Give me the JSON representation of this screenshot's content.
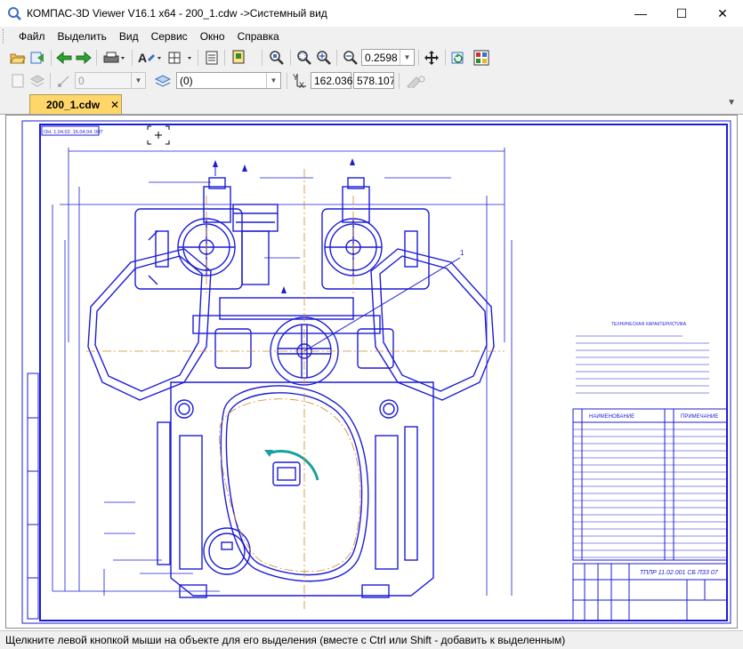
{
  "window": {
    "title": "КОМПАС-3D Viewer V16.1 x64 - 200_1.cdw ->Системный вид",
    "minimize_glyph": "—",
    "maximize_glyph": "☐",
    "close_glyph": "✕"
  },
  "menu": [
    "Файл",
    "Выделить",
    "Вид",
    "Сервис",
    "Окно",
    "Справка"
  ],
  "toolbar1": {
    "zoom_value": "0.2598",
    "icons": [
      "open-icon",
      "open-recent-icon",
      "back-arrow-icon",
      "forward-arrow-icon",
      "print-icon",
      "text-style-icon",
      "grid-icon",
      "properties-icon",
      "view-manager-icon",
      "zoom-fit-icon",
      "zoom-in-icon",
      "zoom-out-icon",
      "zoom-scale-icon",
      "pan-icon",
      "refresh-icon",
      "layers-color-icon"
    ]
  },
  "toolbar2": {
    "layer_value": "0",
    "view_value": "(0)",
    "coord_x": "162.036",
    "coord_y": "578.1078",
    "coord_icon_label": "Y\nX"
  },
  "tab": {
    "label": "200_1.cdw",
    "close_glyph": "✕",
    "arrow_glyph": "▼"
  },
  "drawing": {
    "tech_heading": "ТЕХНИЧЕСКАЯ ХАРАКТЕРИСТИКА",
    "parts_header_name": "НАИМЕНОВАНИЕ",
    "parts_header_note": "ПРИМЕЧАНИЕ",
    "title_block_code": "ТПЛР 11.02.001 СБ ЛЗ3 07",
    "corner_stamp": "ОН. 1.04.02. 16.04.04. 00Т",
    "leader_label_1": "1",
    "colors": {
      "line": "#1c1cd6",
      "center": "#d08a30",
      "frame": "#1c1cd6"
    }
  },
  "status": {
    "text": "Щелкните левой кнопкой мыши на объекте для его выделения (вместе с Ctrl или Shift - добавить к выделенным)"
  }
}
